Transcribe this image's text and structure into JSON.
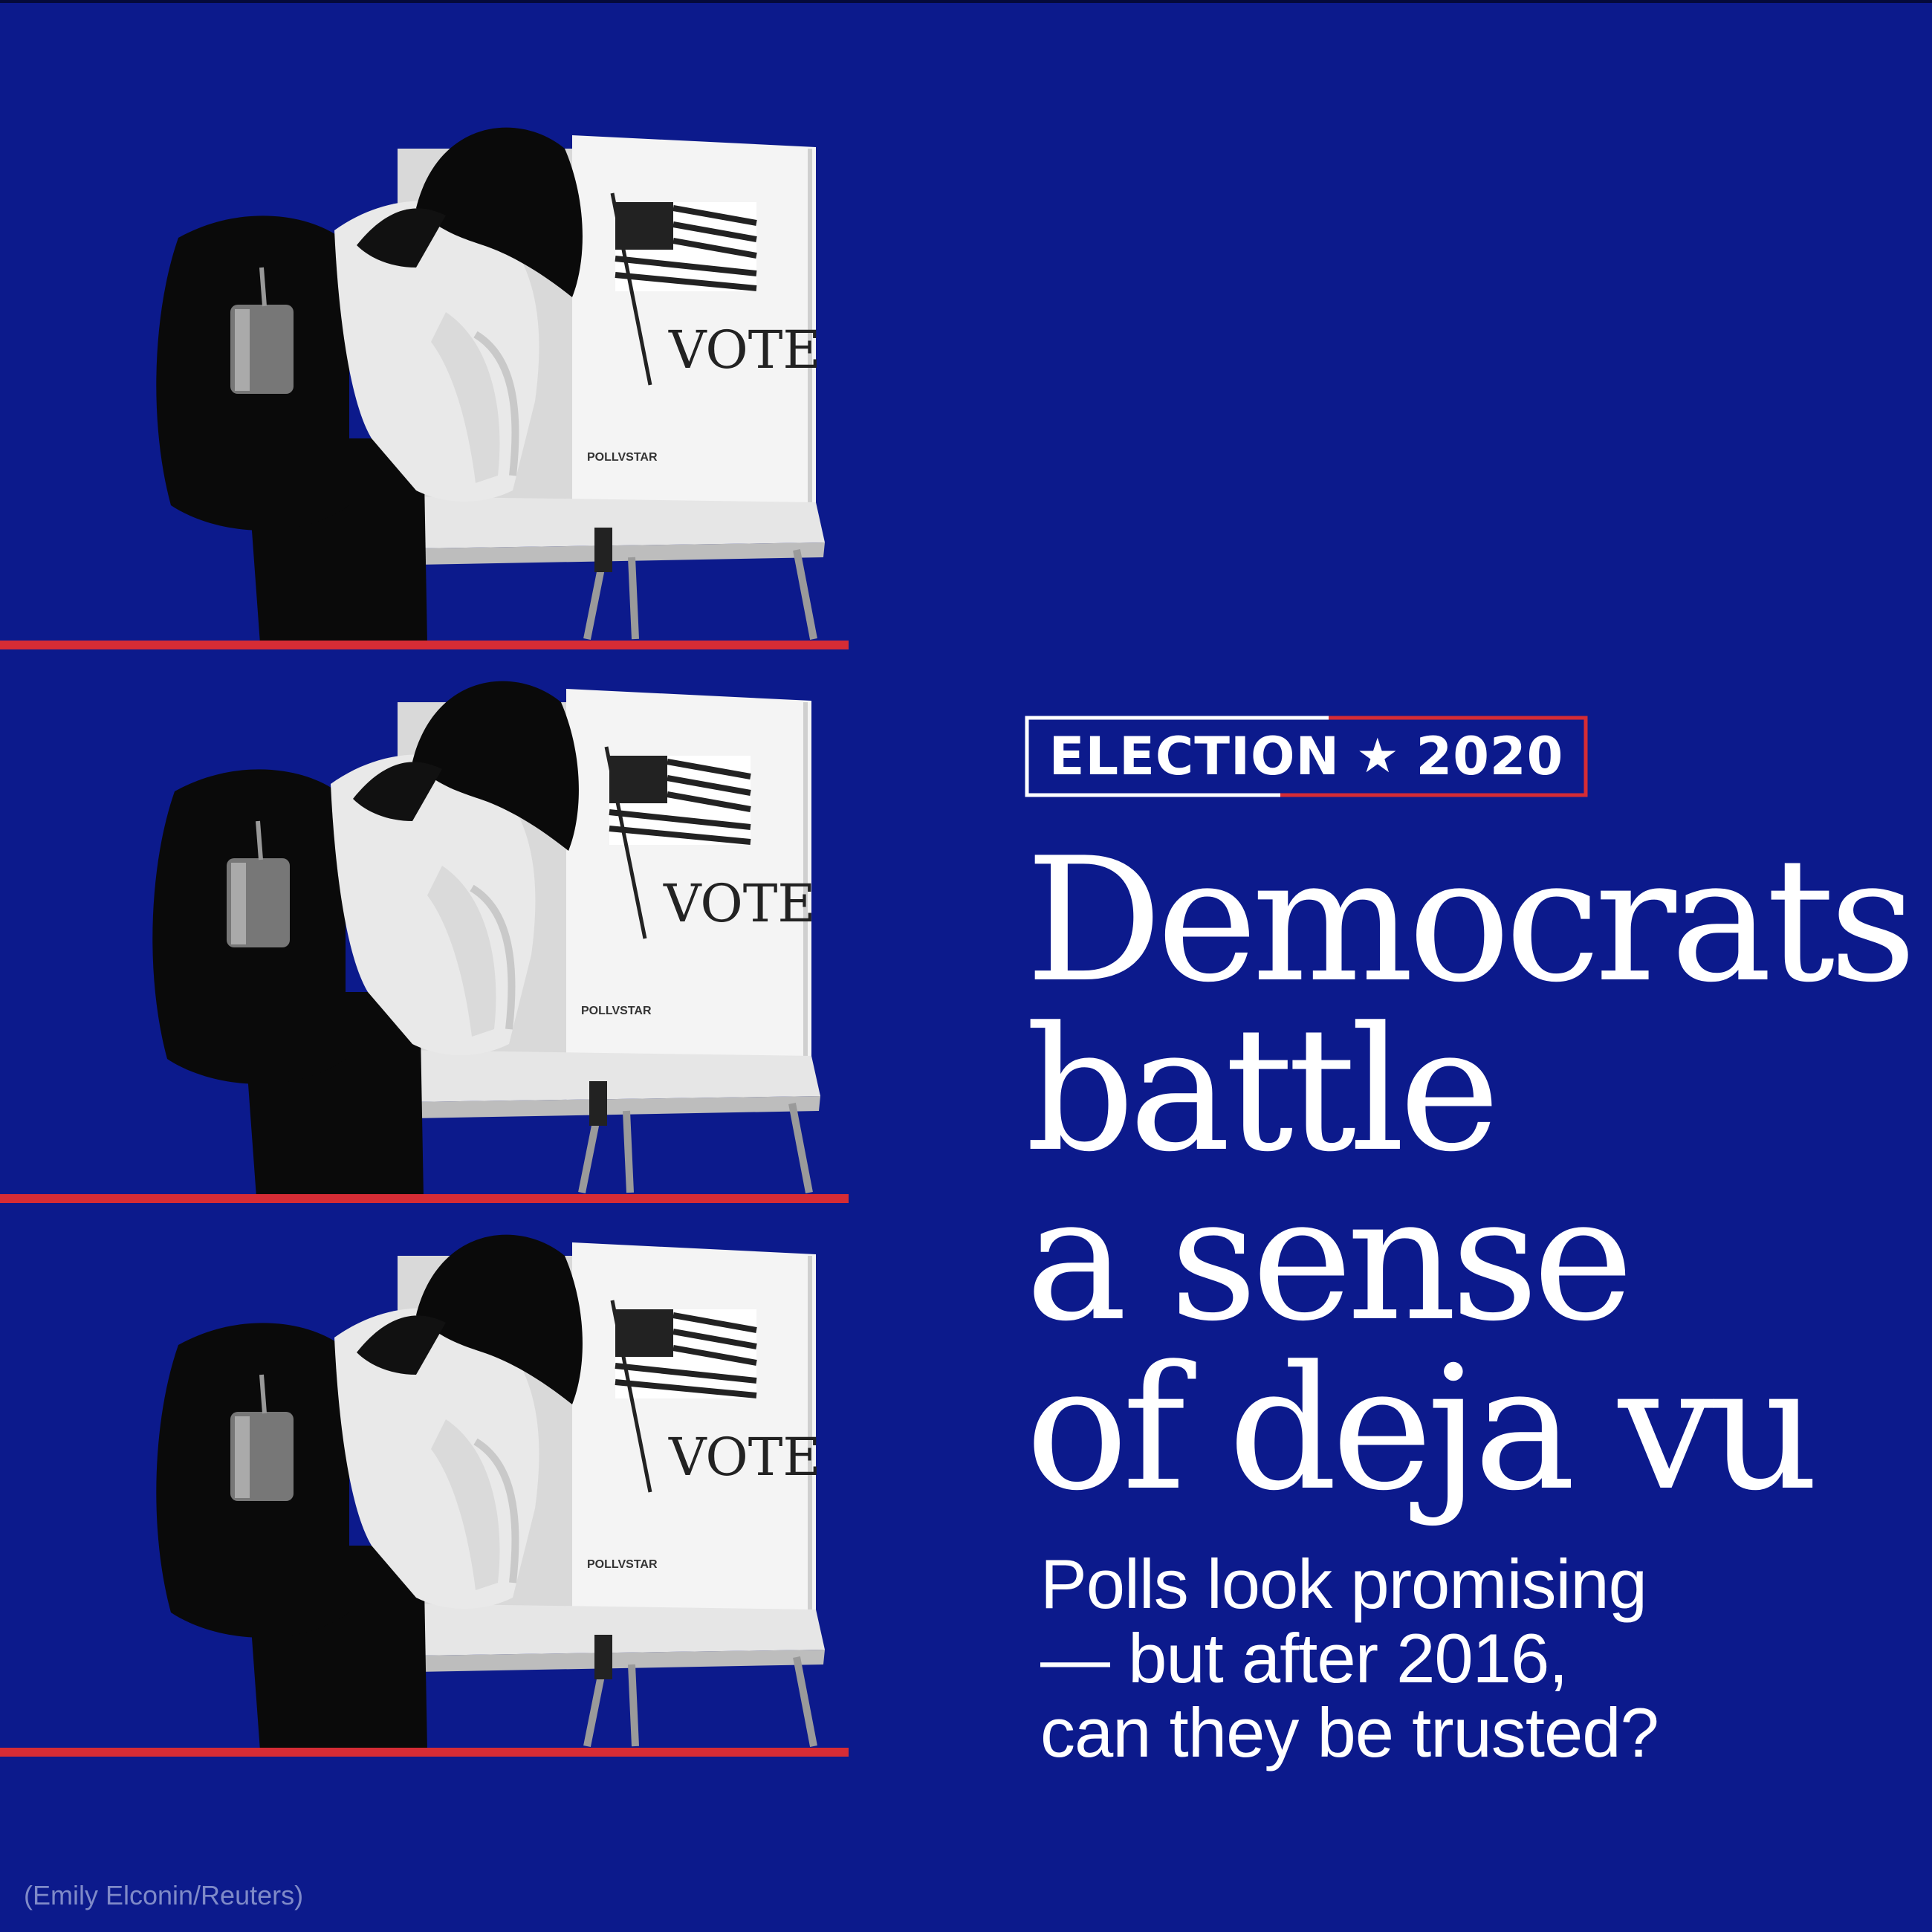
{
  "colors": {
    "background": "#0c1a8c",
    "accent_red": "#d62c35",
    "text": "#ffffff",
    "credit_text": "#7f8ac8"
  },
  "photo": {
    "description_icon": "voter-at-booth-photo",
    "booth_text": "VOTE",
    "booth_logo": "POLLVSTAR"
  },
  "badge": {
    "word": "ELECTION",
    "year": "2020",
    "star": "★"
  },
  "headline": {
    "lines": [
      "Democrats",
      "battle",
      "a sense",
      "of deja vu"
    ]
  },
  "subhead": {
    "lines": [
      "Polls look promising",
      "— but after 2016,",
      "can they be trusted?"
    ]
  },
  "credit": "(Emily Elconin/Reuters)"
}
